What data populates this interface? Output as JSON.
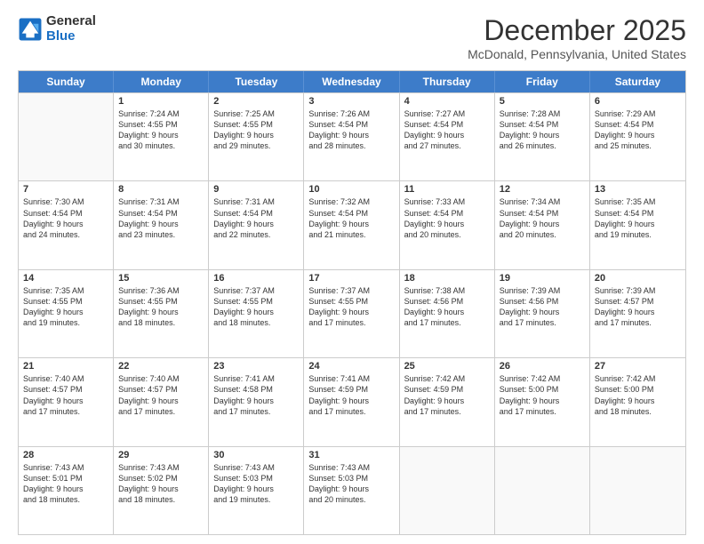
{
  "logo": {
    "line1": "General",
    "line2": "Blue"
  },
  "title": "December 2025",
  "location": "McDonald, Pennsylvania, United States",
  "header_days": [
    "Sunday",
    "Monday",
    "Tuesday",
    "Wednesday",
    "Thursday",
    "Friday",
    "Saturday"
  ],
  "weeks": [
    [
      {
        "day": "",
        "info": ""
      },
      {
        "day": "1",
        "info": "Sunrise: 7:24 AM\nSunset: 4:55 PM\nDaylight: 9 hours\nand 30 minutes."
      },
      {
        "day": "2",
        "info": "Sunrise: 7:25 AM\nSunset: 4:55 PM\nDaylight: 9 hours\nand 29 minutes."
      },
      {
        "day": "3",
        "info": "Sunrise: 7:26 AM\nSunset: 4:54 PM\nDaylight: 9 hours\nand 28 minutes."
      },
      {
        "day": "4",
        "info": "Sunrise: 7:27 AM\nSunset: 4:54 PM\nDaylight: 9 hours\nand 27 minutes."
      },
      {
        "day": "5",
        "info": "Sunrise: 7:28 AM\nSunset: 4:54 PM\nDaylight: 9 hours\nand 26 minutes."
      },
      {
        "day": "6",
        "info": "Sunrise: 7:29 AM\nSunset: 4:54 PM\nDaylight: 9 hours\nand 25 minutes."
      }
    ],
    [
      {
        "day": "7",
        "info": "Sunrise: 7:30 AM\nSunset: 4:54 PM\nDaylight: 9 hours\nand 24 minutes."
      },
      {
        "day": "8",
        "info": "Sunrise: 7:31 AM\nSunset: 4:54 PM\nDaylight: 9 hours\nand 23 minutes."
      },
      {
        "day": "9",
        "info": "Sunrise: 7:31 AM\nSunset: 4:54 PM\nDaylight: 9 hours\nand 22 minutes."
      },
      {
        "day": "10",
        "info": "Sunrise: 7:32 AM\nSunset: 4:54 PM\nDaylight: 9 hours\nand 21 minutes."
      },
      {
        "day": "11",
        "info": "Sunrise: 7:33 AM\nSunset: 4:54 PM\nDaylight: 9 hours\nand 20 minutes."
      },
      {
        "day": "12",
        "info": "Sunrise: 7:34 AM\nSunset: 4:54 PM\nDaylight: 9 hours\nand 20 minutes."
      },
      {
        "day": "13",
        "info": "Sunrise: 7:35 AM\nSunset: 4:54 PM\nDaylight: 9 hours\nand 19 minutes."
      }
    ],
    [
      {
        "day": "14",
        "info": "Sunrise: 7:35 AM\nSunset: 4:55 PM\nDaylight: 9 hours\nand 19 minutes."
      },
      {
        "day": "15",
        "info": "Sunrise: 7:36 AM\nSunset: 4:55 PM\nDaylight: 9 hours\nand 18 minutes."
      },
      {
        "day": "16",
        "info": "Sunrise: 7:37 AM\nSunset: 4:55 PM\nDaylight: 9 hours\nand 18 minutes."
      },
      {
        "day": "17",
        "info": "Sunrise: 7:37 AM\nSunset: 4:55 PM\nDaylight: 9 hours\nand 17 minutes."
      },
      {
        "day": "18",
        "info": "Sunrise: 7:38 AM\nSunset: 4:56 PM\nDaylight: 9 hours\nand 17 minutes."
      },
      {
        "day": "19",
        "info": "Sunrise: 7:39 AM\nSunset: 4:56 PM\nDaylight: 9 hours\nand 17 minutes."
      },
      {
        "day": "20",
        "info": "Sunrise: 7:39 AM\nSunset: 4:57 PM\nDaylight: 9 hours\nand 17 minutes."
      }
    ],
    [
      {
        "day": "21",
        "info": "Sunrise: 7:40 AM\nSunset: 4:57 PM\nDaylight: 9 hours\nand 17 minutes."
      },
      {
        "day": "22",
        "info": "Sunrise: 7:40 AM\nSunset: 4:57 PM\nDaylight: 9 hours\nand 17 minutes."
      },
      {
        "day": "23",
        "info": "Sunrise: 7:41 AM\nSunset: 4:58 PM\nDaylight: 9 hours\nand 17 minutes."
      },
      {
        "day": "24",
        "info": "Sunrise: 7:41 AM\nSunset: 4:59 PM\nDaylight: 9 hours\nand 17 minutes."
      },
      {
        "day": "25",
        "info": "Sunrise: 7:42 AM\nSunset: 4:59 PM\nDaylight: 9 hours\nand 17 minutes."
      },
      {
        "day": "26",
        "info": "Sunrise: 7:42 AM\nSunset: 5:00 PM\nDaylight: 9 hours\nand 17 minutes."
      },
      {
        "day": "27",
        "info": "Sunrise: 7:42 AM\nSunset: 5:00 PM\nDaylight: 9 hours\nand 18 minutes."
      }
    ],
    [
      {
        "day": "28",
        "info": "Sunrise: 7:43 AM\nSunset: 5:01 PM\nDaylight: 9 hours\nand 18 minutes."
      },
      {
        "day": "29",
        "info": "Sunrise: 7:43 AM\nSunset: 5:02 PM\nDaylight: 9 hours\nand 18 minutes."
      },
      {
        "day": "30",
        "info": "Sunrise: 7:43 AM\nSunset: 5:03 PM\nDaylight: 9 hours\nand 19 minutes."
      },
      {
        "day": "31",
        "info": "Sunrise: 7:43 AM\nSunset: 5:03 PM\nDaylight: 9 hours\nand 20 minutes."
      },
      {
        "day": "",
        "info": ""
      },
      {
        "day": "",
        "info": ""
      },
      {
        "day": "",
        "info": ""
      }
    ]
  ]
}
